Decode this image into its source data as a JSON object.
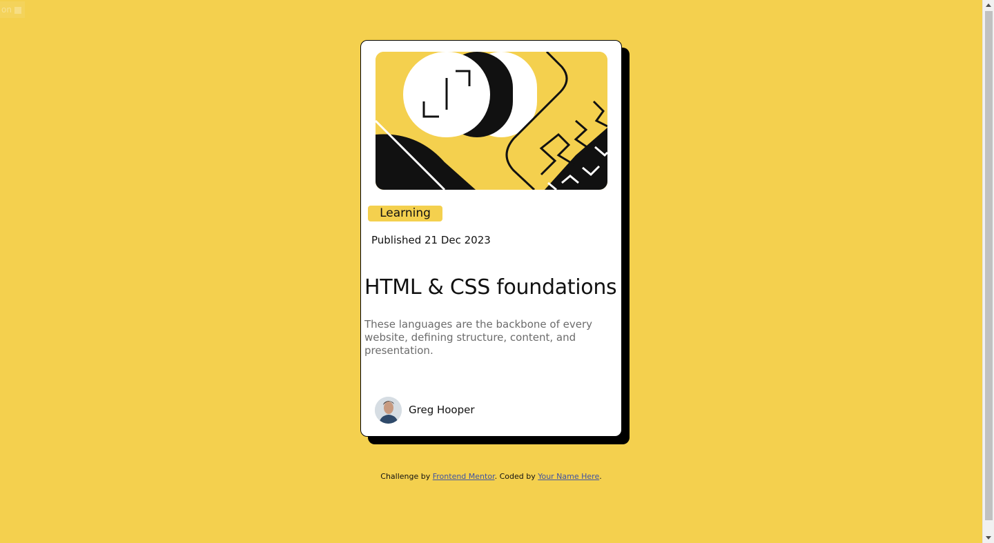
{
  "corner_badge": {
    "label": "on"
  },
  "card": {
    "tag": "Learning",
    "published": "Published 21 Dec 2023",
    "title": "HTML & CSS foundations",
    "description": "These languages are the backbone of every website, defining structure, content, and presentation.",
    "author": {
      "name": "Greg Hooper"
    }
  },
  "footer": {
    "prefix": "Challenge by ",
    "link1": "Frontend Mentor",
    "middle": ". Coded by ",
    "link2": "Your Name Here",
    "suffix": "."
  },
  "colors": {
    "background": "#f4d04e",
    "card": "#ffffff",
    "shadow": "#000000",
    "description": "#6b6b6b",
    "link": "#3e52a3"
  }
}
